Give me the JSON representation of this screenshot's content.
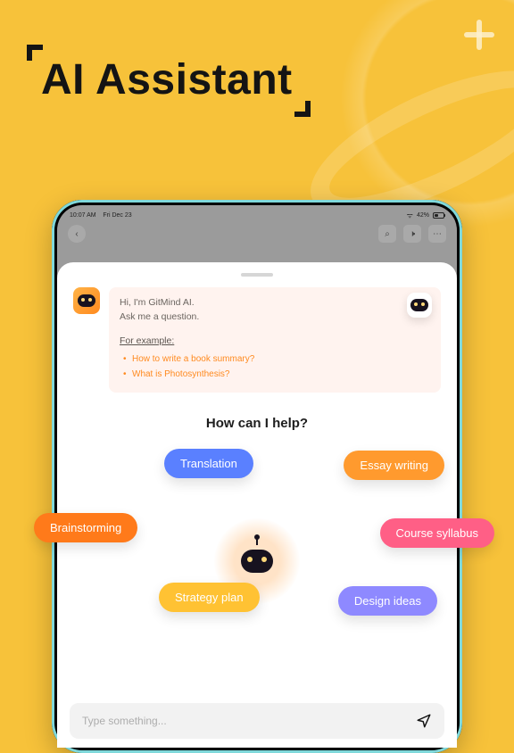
{
  "hero": {
    "title": "AI Assistant"
  },
  "statusbar": {
    "time": "10:07 AM",
    "date": "Fri Dec 23",
    "battery": "42%"
  },
  "intro": {
    "line1": "Hi, I'm GitMind AI.",
    "line2": "Ask me a question."
  },
  "examples": {
    "heading": "For example:",
    "items": [
      "How to write a book summary?",
      "What is Photosynthesis?"
    ]
  },
  "help_heading": "How can I help?",
  "chips": {
    "translation": "Translation",
    "essay": "Essay writing",
    "brainstorming": "Brainstorming",
    "course": "Course syllabus",
    "strategy": "Strategy plan",
    "design": "Design ideas"
  },
  "composer": {
    "placeholder": "Type something..."
  },
  "colors": {
    "bg": "#f7c23a",
    "chip_blue": "#5a80ff",
    "chip_orange": "#ff9a2e",
    "chip_dorange": "#ff7a1a",
    "chip_pink": "#ff5f86",
    "chip_yellow": "#ffc233",
    "chip_purple": "#8e89ff"
  }
}
